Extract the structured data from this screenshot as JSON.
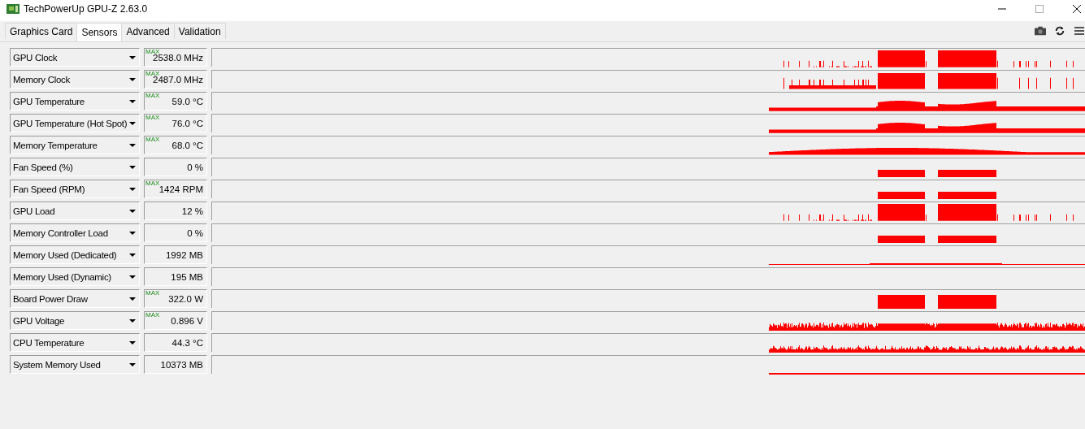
{
  "window": {
    "title": "TechPowerUp GPU-Z 2.63.0"
  },
  "tabs": [
    {
      "label": "Graphics Card",
      "selected": false
    },
    {
      "label": "Sensors",
      "selected": true
    },
    {
      "label": "Advanced",
      "selected": false
    },
    {
      "label": "Validation",
      "selected": false
    }
  ],
  "sensors": [
    {
      "name": "GPU Clock",
      "badge": "MAX",
      "value": "2538.0 MHz"
    },
    {
      "name": "Memory Clock",
      "badge": "MAX",
      "value": "2487.0 MHz"
    },
    {
      "name": "GPU Temperature",
      "badge": "MAX",
      "value": "59.0 °C"
    },
    {
      "name": "GPU Temperature (Hot Spot)",
      "badge": "MAX",
      "value": "76.0 °C"
    },
    {
      "name": "Memory Temperature",
      "badge": "MAX",
      "value": "68.0 °C"
    },
    {
      "name": "Fan Speed (%)",
      "value": "0 %"
    },
    {
      "name": "Fan Speed (RPM)",
      "badge": "MAX",
      "value": "1424 RPM"
    },
    {
      "name": "GPU Load",
      "value": "12 %"
    },
    {
      "name": "Memory Controller Load",
      "value": "0 %"
    },
    {
      "name": "Memory Used (Dedicated)",
      "value": "1992 MB"
    },
    {
      "name": "Memory Used (Dynamic)",
      "value": "195 MB"
    },
    {
      "name": "Board Power Draw",
      "badge": "MAX",
      "value": "322.0 W"
    },
    {
      "name": "GPU Voltage",
      "badge": "MAX",
      "value": "0.896 V"
    },
    {
      "name": "CPU Temperature",
      "value": "44.3 °C"
    },
    {
      "name": "System Memory Used",
      "value": "10373 MB"
    }
  ]
}
